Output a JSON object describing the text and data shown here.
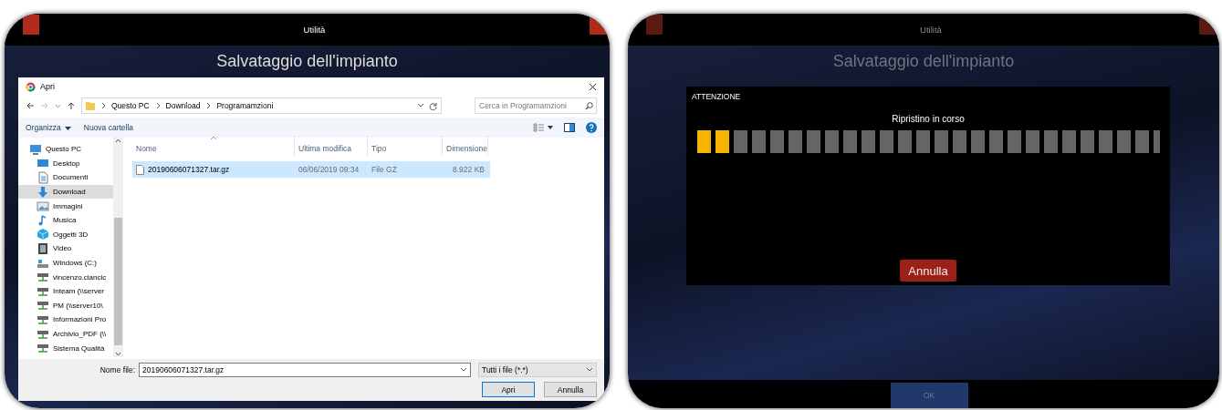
{
  "screens": [
    {
      "header": "Utilità",
      "title": "Salvataggio dell'impianto",
      "dimmed": false,
      "content": {
        "kind": "file_dialog",
        "window_title": "Apri",
        "address": [
          "Questo PC",
          "Download",
          "Programamzioni"
        ],
        "search_placeholder": "Cerca in Programamzioni",
        "toolbar": [
          "Organizza",
          "Nuova cartella"
        ],
        "sidebar": [
          {
            "label": "Questo PC",
            "kind": "pc",
            "selected": false,
            "children": [
              {
                "label": "Desktop",
                "kind": "desktop",
                "selected": false
              },
              {
                "label": "Documenti",
                "kind": "documents",
                "selected": false
              },
              {
                "label": "Download",
                "kind": "download",
                "selected": true
              },
              {
                "label": "Immagini",
                "kind": "pictures",
                "selected": false
              },
              {
                "label": "Musica",
                "kind": "music",
                "selected": false
              },
              {
                "label": "Oggetti 3D",
                "kind": "objects",
                "selected": false
              },
              {
                "label": "Video",
                "kind": "video",
                "selected": false
              },
              {
                "label": "Windows (C:)",
                "kind": "drive",
                "selected": false
              },
              {
                "label": "vincenzo.ciancic",
                "kind": "network",
                "selected": false
              },
              {
                "label": "Inteam (\\\\server",
                "kind": "network",
                "selected": false
              },
              {
                "label": "PM (\\\\server10\\",
                "kind": "network",
                "selected": false
              },
              {
                "label": "Informazioni Pro",
                "kind": "network",
                "selected": false
              },
              {
                "label": "Archivio_PDF (\\\\",
                "kind": "network",
                "selected": false
              },
              {
                "label": "Sistema Qualità",
                "kind": "network",
                "selected": false
              }
            ]
          }
        ],
        "columns": [
          {
            "label": "Nome",
            "sorted": true
          },
          {
            "label": "Ultima modifica",
            "sorted": false
          },
          {
            "label": "Tipo",
            "sorted": false
          },
          {
            "label": "Dimensione",
            "sorted": false
          }
        ],
        "rows": [
          {
            "cells": [
              "20190606071327.tar.gz",
              "06/06/2019 09:34",
              "File GZ",
              "8.922 KB"
            ],
            "selected": true
          }
        ],
        "file_name_label": "Nome file:",
        "file_name": "20190606071327.tar.gz",
        "file_type": "Tutti i file (*.*)",
        "buttons": [
          {
            "label": "Apri",
            "default": true
          },
          {
            "label": "Annulla",
            "default": false
          }
        ]
      }
    },
    {
      "header": "Utilità",
      "title": "Salvataggio dell'impianto",
      "dimmed": true,
      "content": {
        "kind": "restore_progress",
        "heading": "ATTENZIONE",
        "message": "Ripristino in corso",
        "progress": {
          "level": 0.08
        },
        "cancel_button": "Annulla",
        "ok_button": "OK"
      }
    }
  ]
}
